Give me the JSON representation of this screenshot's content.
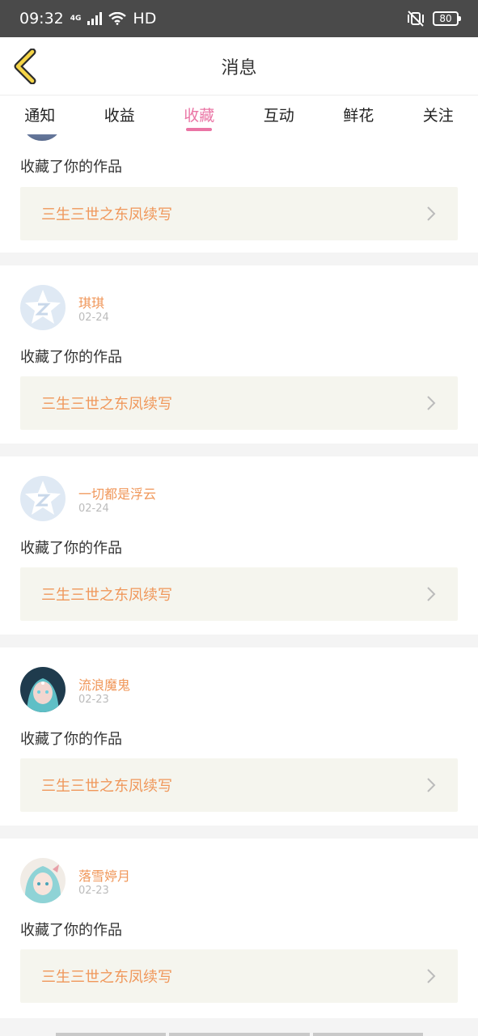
{
  "status": {
    "time": "09:32",
    "net": "4G",
    "hd": "HD",
    "battery": "80"
  },
  "navbar": {
    "title": "消息"
  },
  "tabs": [
    {
      "label": "通知"
    },
    {
      "label": "收益"
    },
    {
      "label": "收藏",
      "active": true
    },
    {
      "label": "互动"
    },
    {
      "label": "鲜花"
    },
    {
      "label": "关注"
    }
  ],
  "items": [
    {
      "user": "",
      "date": "",
      "action": "收藏了你的作品",
      "work": "三生三世之东凤续写"
    },
    {
      "user": "琪琪",
      "date": "02-24",
      "action": "收藏了你的作品",
      "work": "三生三世之东凤续写",
      "avatar": "default-avatar-icon"
    },
    {
      "user": "一切都是浮云",
      "date": "02-24",
      "action": "收藏了你的作品",
      "work": "三生三世之东凤续写",
      "avatar": "default-avatar-icon"
    },
    {
      "user": "流浪魔鬼",
      "date": "02-23",
      "action": "收藏了你的作品",
      "work": "三生三世之东凤续写",
      "avatar": "anime-avatar"
    },
    {
      "user": "落雪婷月",
      "date": "02-23",
      "action": "收藏了你的作品",
      "work": "三生三世之东凤续写",
      "avatar": "anime-avatar"
    }
  ],
  "colors": {
    "accent": "#ea75a5",
    "link": "#f0975a",
    "back_icon": "#f5d547"
  }
}
